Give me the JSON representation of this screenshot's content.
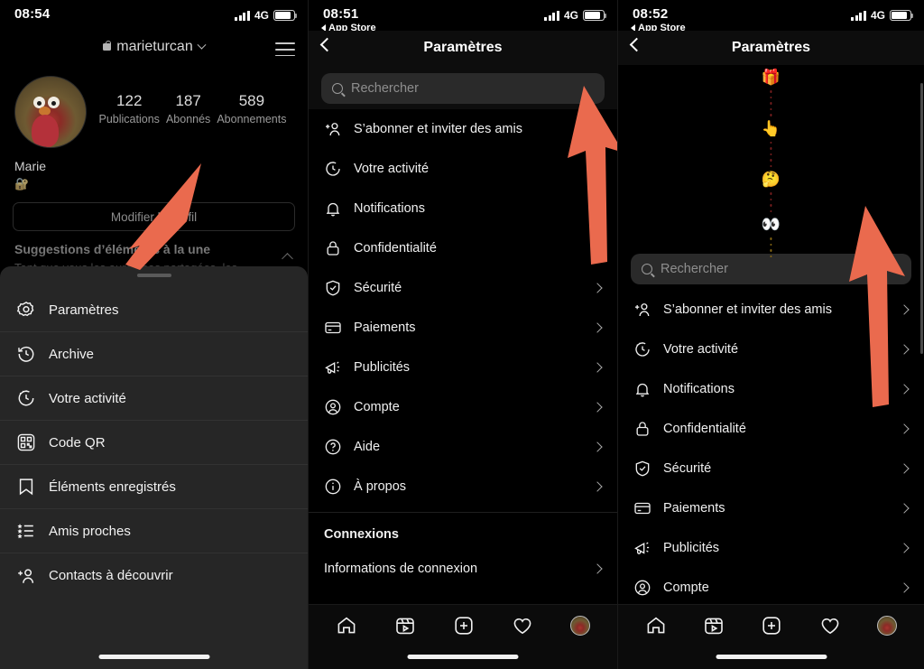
{
  "accent": {
    "arrow": "#ea6a4e"
  },
  "panel1": {
    "statusbar": {
      "time": "08:54",
      "network": "4G"
    },
    "profile": {
      "username": "marieturcan",
      "lock_icon": "lock-icon",
      "menu_icon": "hamburger-menu-icon",
      "stats": [
        {
          "num": "122",
          "label": "Publications"
        },
        {
          "num": "187",
          "label": "Abonnés"
        },
        {
          "num": "589",
          "label": "Abonnements"
        }
      ],
      "display_name": "Marie",
      "bio_emoji": "🔐",
      "edit_button": "Modifier le profil",
      "suggestion_title": "Suggestions d’éléments à la une",
      "suggestion_text": "Tant que vous les aurez pas partagées, les"
    },
    "sheet": {
      "items": [
        {
          "label": "Paramètres",
          "icon": "settings-gear-icon"
        },
        {
          "label": "Archive",
          "icon": "archive-clock-icon"
        },
        {
          "label": "Votre activité",
          "icon": "activity-clock-icon"
        },
        {
          "label": "Code QR",
          "icon": "qr-code-icon"
        },
        {
          "label": "Éléments enregistrés",
          "icon": "bookmark-icon"
        },
        {
          "label": "Amis proches",
          "icon": "close-friends-list-icon"
        },
        {
          "label": "Contacts à découvrir",
          "icon": "add-person-icon"
        }
      ]
    }
  },
  "panel2": {
    "statusbar": {
      "time": "08:51",
      "network": "4G",
      "back_app": "App Store"
    },
    "navbar": {
      "title": "Paramètres",
      "back_icon": "chevron-left-icon"
    },
    "search": {
      "placeholder": "Rechercher"
    },
    "items": [
      {
        "label": "S’abonner et inviter des amis",
        "icon": "add-person-icon"
      },
      {
        "label": "Votre activité",
        "icon": "activity-clock-icon"
      },
      {
        "label": "Notifications",
        "icon": "bell-icon"
      },
      {
        "label": "Confidentialité",
        "icon": "lock-icon"
      },
      {
        "label": "Sécurité",
        "icon": "shield-check-icon"
      },
      {
        "label": "Paiements",
        "icon": "credit-card-icon"
      },
      {
        "label": "Publicités",
        "icon": "megaphone-icon"
      },
      {
        "label": "Compte",
        "icon": "account-circle-icon"
      },
      {
        "label": "Aide",
        "icon": "help-circle-icon"
      },
      {
        "label": "À propos",
        "icon": "info-circle-icon"
      }
    ],
    "section": {
      "title": "Connexions",
      "items": [
        {
          "label": "Informations de connexion",
          "icon": "none"
        }
      ]
    },
    "tabbar": [
      "home-icon",
      "reels-icon",
      "add-post-icon",
      "heart-icon",
      "profile-avatar"
    ]
  },
  "panel3": {
    "statusbar": {
      "time": "08:52",
      "network": "4G",
      "back_app": "App Store"
    },
    "navbar": {
      "title": "Paramètres",
      "back_icon": "chevron-left-icon"
    },
    "decoration": {
      "emojis": [
        "🎁",
        "👆",
        "🤔",
        "👀"
      ]
    },
    "search": {
      "placeholder": "Rechercher"
    },
    "items": [
      {
        "label": "S’abonner et inviter des amis",
        "icon": "add-person-icon"
      },
      {
        "label": "Votre activité",
        "icon": "activity-clock-icon"
      },
      {
        "label": "Notifications",
        "icon": "bell-icon"
      },
      {
        "label": "Confidentialité",
        "icon": "lock-icon"
      },
      {
        "label": "Sécurité",
        "icon": "shield-check-icon"
      },
      {
        "label": "Paiements",
        "icon": "credit-card-icon"
      },
      {
        "label": "Publicités",
        "icon": "megaphone-icon"
      },
      {
        "label": "Compte",
        "icon": "account-circle-icon"
      }
    ],
    "tabbar": [
      "home-icon",
      "reels-icon",
      "add-post-icon",
      "heart-icon",
      "profile-avatar"
    ]
  }
}
